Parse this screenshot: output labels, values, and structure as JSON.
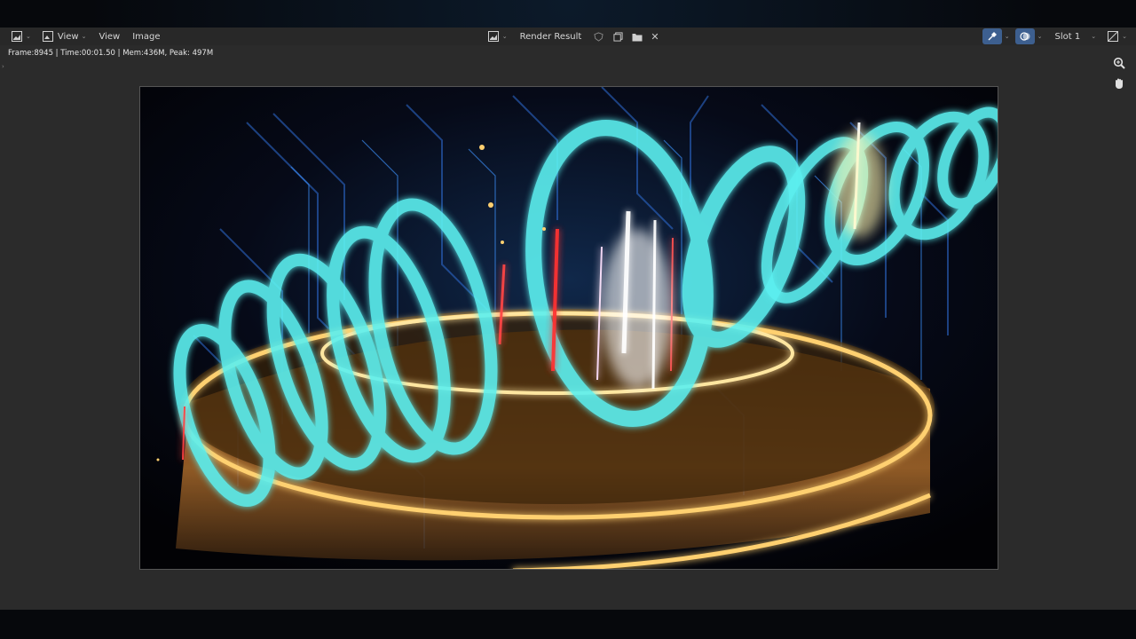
{
  "header": {
    "editor_type_icon": "image-editor-icon",
    "menus": [
      "View",
      "Image"
    ],
    "view_mode_label": "View",
    "image_name": "Render Result",
    "slot_label": "Slot 1"
  },
  "status": {
    "stats": "Frame:8945 | Time:00:01.50 | Mem:436M, Peak: 497M"
  },
  "tools": {
    "zoom_icon": "magnifier-icon",
    "pan_icon": "hand-icon"
  },
  "colors": {
    "panel": "#2b2b2b",
    "header": "#262626",
    "accent_blue": "#4a8ad8",
    "ring_cyan": "#5cf0f0",
    "ring_gold": "#ffd070"
  }
}
